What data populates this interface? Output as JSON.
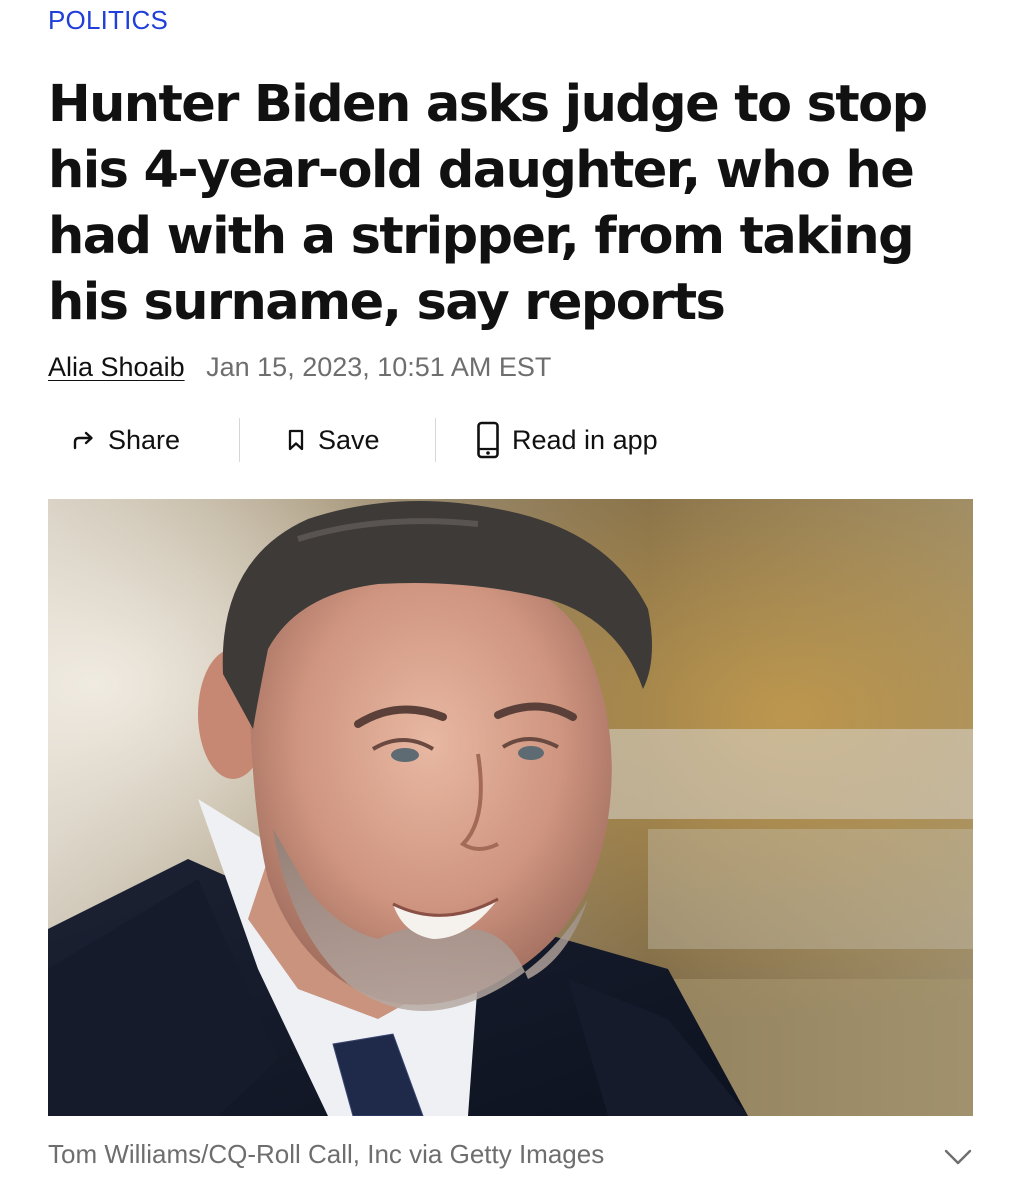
{
  "article": {
    "category": "POLITICS",
    "headline": "Hunter Biden asks judge to stop his 4-year-old daughter, who he had with a stripper, from taking his surname, say reports",
    "author": "Alia Shoaib",
    "timestamp": "Jan 15, 2023, 10:51 AM EST"
  },
  "actions": {
    "share_label": "Share",
    "save_label": "Save",
    "read_in_app_label": "Read in app"
  },
  "icons": {
    "share": "share-arrow-icon",
    "save": "bookmark-icon",
    "read_in_app": "phone-icon",
    "caption_toggle": "chevron-down-icon"
  },
  "hero_image": {
    "caption": "Tom Williams/CQ-Roll Call, Inc via Getty Images"
  },
  "colors": {
    "category": "#1f3fd8",
    "text": "#111111",
    "muted": "#6e6e6e",
    "divider": "#d6d6d6"
  }
}
